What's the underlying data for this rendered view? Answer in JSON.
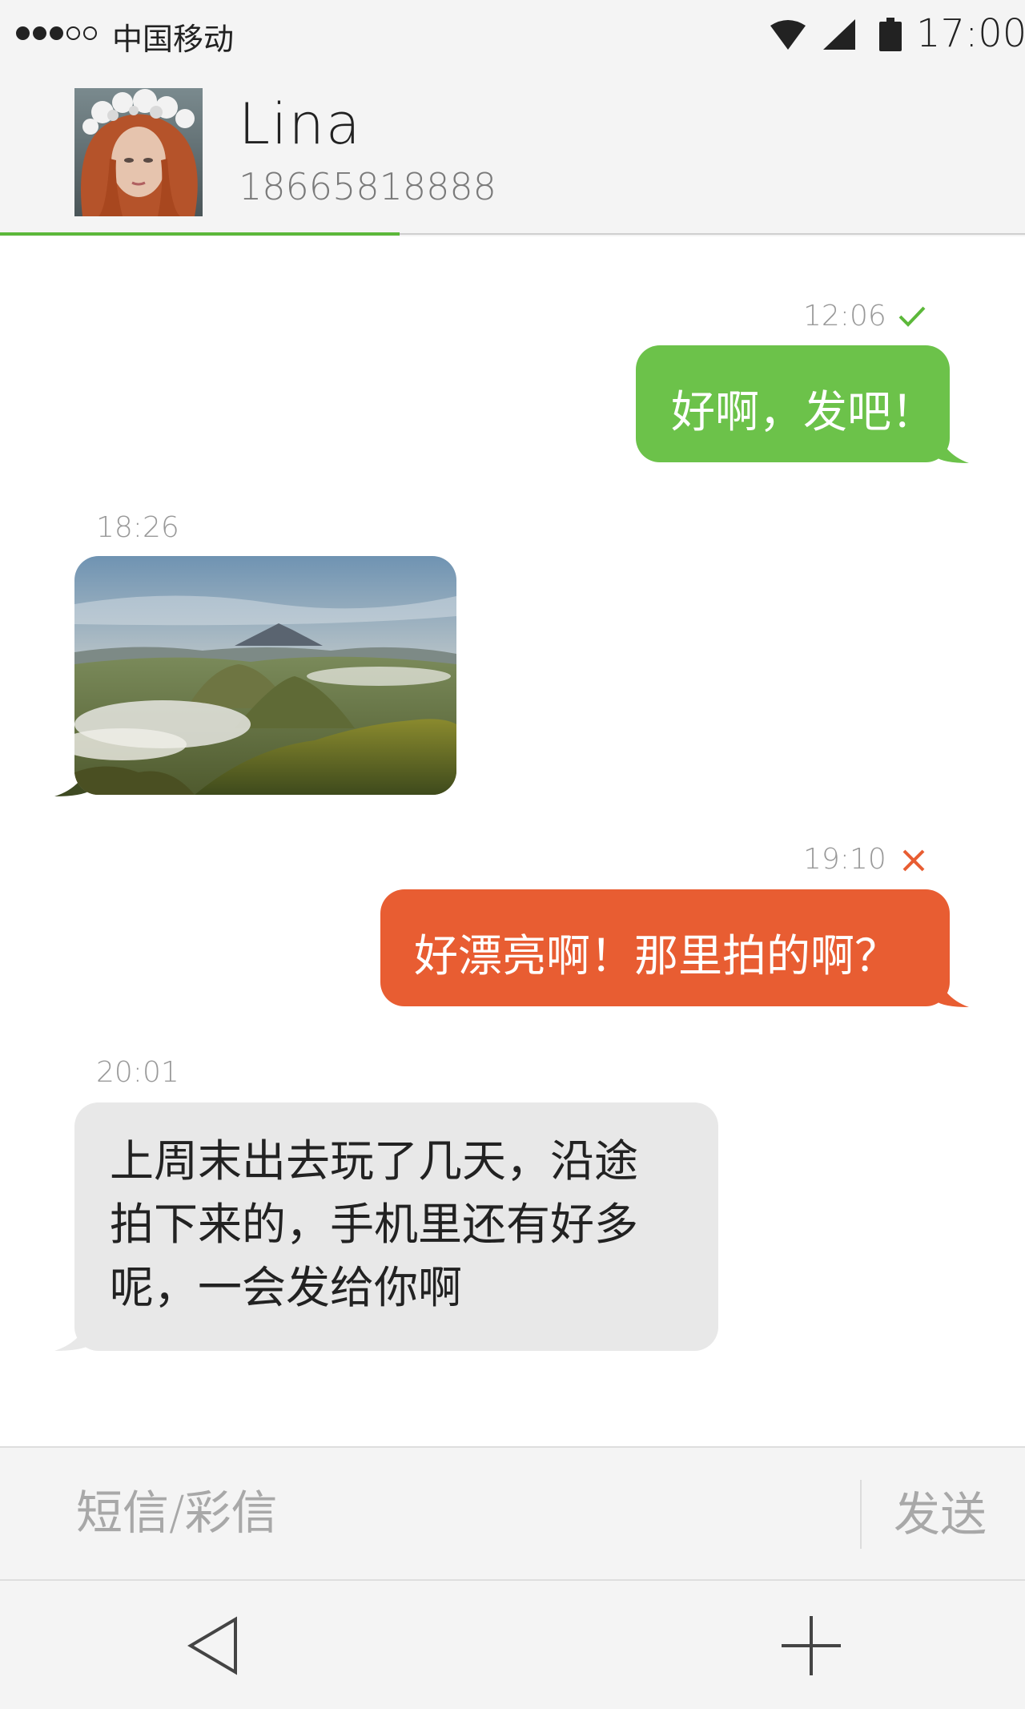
{
  "status_bar": {
    "carrier": "中国移动",
    "time": "17:00",
    "icons": [
      "signal-dots-icon",
      "wifi-icon",
      "cellular-signal-icon",
      "battery-icon"
    ]
  },
  "contact": {
    "name": "Lina",
    "number": "18665818888"
  },
  "progress_fraction": 0.39,
  "messages": [
    {
      "direction": "sent",
      "time": "12:06",
      "status": "delivered",
      "status_icon": "check-icon",
      "text": "好啊，发吧！",
      "color": "#6cc24a"
    },
    {
      "direction": "received",
      "time": "18:26",
      "type": "image",
      "image": "mountain-landscape-photo"
    },
    {
      "direction": "sent",
      "time": "19:10",
      "status": "failed",
      "status_icon": "cross-icon",
      "text": "好漂亮啊！那里拍的啊？",
      "color": "#e85d32"
    },
    {
      "direction": "received",
      "time": "20:01",
      "text_lines": [
        "上周末出去玩了几天，沿途",
        "拍下来的，手机里还有好多",
        "呢，一会发给你啊"
      ],
      "color": "#e8e8e8"
    }
  ],
  "composer": {
    "placeholder": "短信/彩信",
    "value": "",
    "send_label": "发送"
  },
  "nav": {
    "icons": [
      "back-triangle-icon",
      "plus-icon"
    ]
  },
  "colors": {
    "accent_green": "#5cb83a",
    "failed_orange": "#e85d32"
  }
}
